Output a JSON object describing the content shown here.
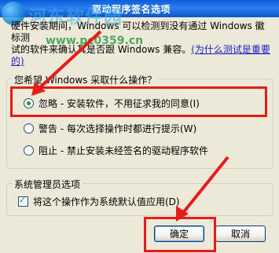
{
  "window": {
    "title": "驱动程序签名选项"
  },
  "watermark": {
    "site_name": "河东软件园",
    "url": "www.pc0359.cn"
  },
  "intro": {
    "line1": "硬件安装期间，Windows 可以检测到没有通过 Windows 徽标测",
    "line2_before": "试的软件来确认其是否跟 Windows 兼容。",
    "line2_link": "(为什么测试是重要的)"
  },
  "options_group": {
    "title": "您希望 Windows 采取什么操作？",
    "options": [
      {
        "label": "忽略 - 安装软件，不用征求我的同意(I)",
        "checked": true
      },
      {
        "label": "警告 - 每次选择操作时都进行提示(W)",
        "checked": false
      },
      {
        "label": "阻止 - 禁止安装未经签名的驱动程序软件",
        "checked": false
      }
    ]
  },
  "admin_group": {
    "title": "系统管理员选项",
    "checkbox_label": "将这个操作作为系统默认值应用(D)",
    "checked": true
  },
  "buttons": {
    "ok": "确定",
    "cancel": "取消"
  },
  "colors": {
    "highlight": "#E81B1B",
    "titlebar": "#0A5ED8",
    "dialog_bg": "#ECE9D8"
  }
}
